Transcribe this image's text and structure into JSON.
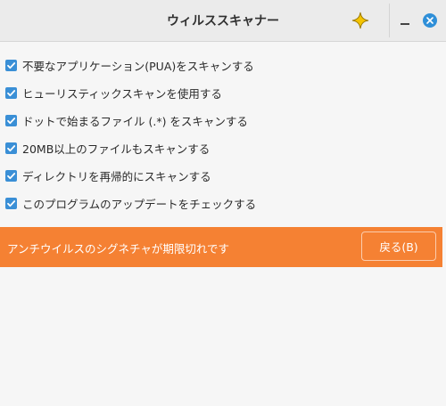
{
  "window": {
    "title": "ウィルススキャナー",
    "sparkle_icon": "sparkle-star-icon",
    "minimize_icon": "minimize-icon",
    "close_icon": "close-icon",
    "accent_color": "#2f8fd8"
  },
  "options": {
    "items": [
      {
        "label": "不要なアプリケーション(PUA)をスキャンする",
        "checked": true
      },
      {
        "label": "ヒューリスティックスキャンを使用する",
        "checked": true
      },
      {
        "label": "ドットで始まるファイル (.*) をスキャンする",
        "checked": true
      },
      {
        "label": "20MB以上のファイルもスキャンする",
        "checked": true
      },
      {
        "label": "ディレクトリを再帰的にスキャンする",
        "checked": true
      },
      {
        "label": "このプログラムのアップデートをチェックする",
        "checked": true
      }
    ]
  },
  "banner": {
    "message": "アンチウイルスのシグネチャが期限切れです",
    "back_label": "戻る(B)",
    "color": "#f58133"
  }
}
